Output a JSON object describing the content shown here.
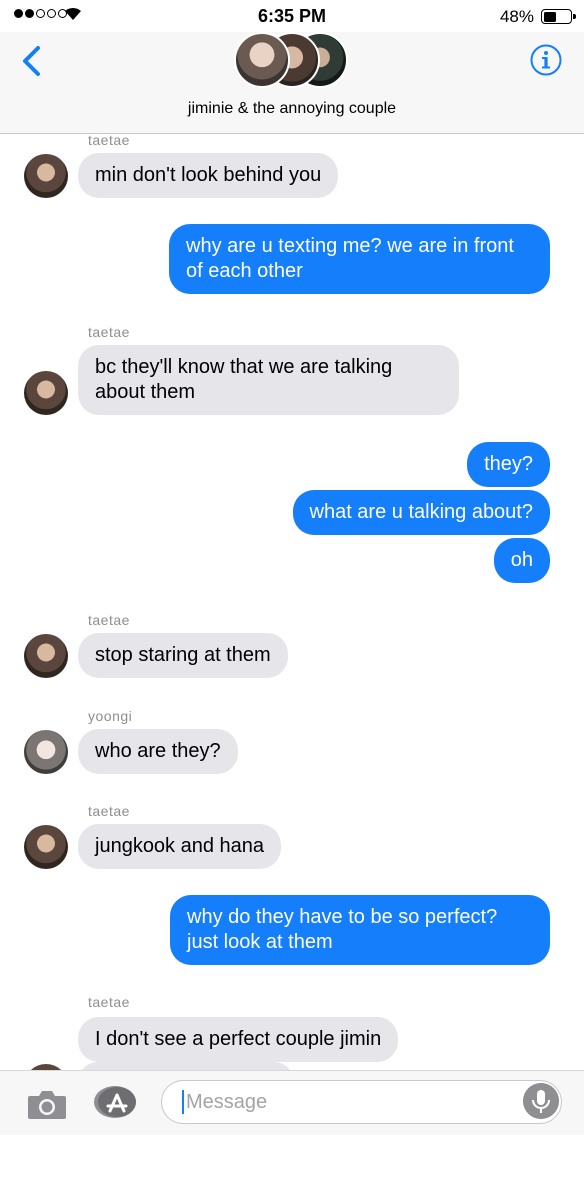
{
  "status_bar": {
    "signal_dots_filled": 2,
    "signal_dots_total": 5,
    "time": "6:35 PM",
    "battery_text": "48%",
    "battery_level": 0.48
  },
  "header": {
    "group_title": "jiminie & the annoying couple",
    "back_icon": "chevron-left-icon",
    "info_icon": "info-icon",
    "accent_color": "#147efb"
  },
  "messages": [
    {
      "side": "in",
      "sender": "taetae",
      "avatar": "taetae",
      "text": "min don't look behind you"
    },
    {
      "side": "out",
      "text": "why are u texting me? we are in front of each other"
    },
    {
      "side": "in",
      "sender": "taetae",
      "avatar": "taetae",
      "text": "bc they'll know that we are talking about them"
    },
    {
      "side": "out",
      "text": "they?"
    },
    {
      "side": "out",
      "text": "what are u talking about?"
    },
    {
      "side": "out",
      "text": "oh"
    },
    {
      "side": "in",
      "sender": "taetae",
      "avatar": "taetae",
      "text": "stop staring at them"
    },
    {
      "side": "in",
      "sender": "yoongi",
      "avatar": "yoongi",
      "text": "who are they?"
    },
    {
      "side": "in",
      "sender": "taetae",
      "avatar": "taetae",
      "text": "jungkook and hana"
    },
    {
      "side": "out",
      "text": "why do they have to be so perfect? just look at them"
    },
    {
      "side": "in",
      "sender": "taetae",
      "avatar": "taetae",
      "text": "I don't see a perfect couple jimin"
    }
  ],
  "composer": {
    "placeholder": "Message",
    "camera_icon": "camera-icon",
    "apps_icon": "app-store-icon",
    "mic_icon": "microphone-icon"
  },
  "colors": {
    "outgoing_bubble": "#147efb",
    "incoming_bubble": "#e5e5ea",
    "header_bg": "#f7f7f7"
  }
}
